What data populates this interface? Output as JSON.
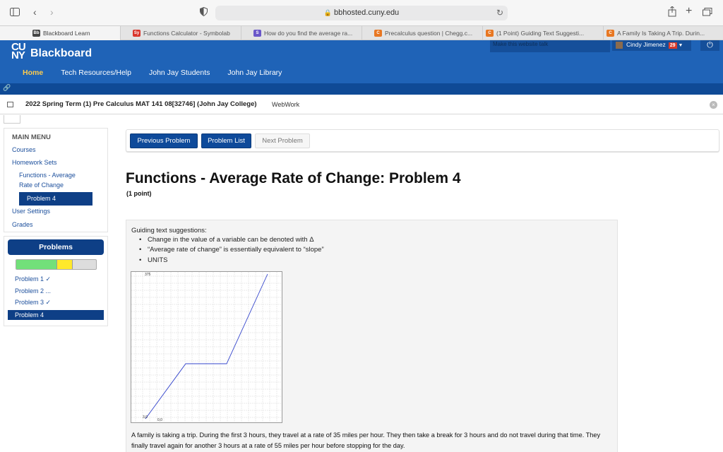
{
  "browser": {
    "url": "bbhosted.cuny.edu",
    "tabs": [
      {
        "label": "Blackboard Learn",
        "fav": "Bb",
        "color": "#444444"
      },
      {
        "label": "Functions Calculator - Symbolab",
        "fav": "Sy",
        "color": "#d9352b"
      },
      {
        "label": "How do you find the average ra...",
        "fav": "S",
        "color": "#6a57c9"
      },
      {
        "label": "Precalculus question | Chegg.c...",
        "fav": "C",
        "color": "#e87722"
      },
      {
        "label": "(1 Point) Guiding Text Suggesti...",
        "fav": "C",
        "color": "#e87722"
      },
      {
        "label": "A Family Is Taking A Trip. Durin...",
        "fav": "C",
        "color": "#e87722"
      }
    ]
  },
  "header": {
    "logo_cuny": "CU NY",
    "logo_name": "Blackboard",
    "talk_text": "Make this website talk",
    "user_name": "Cindy Jimenez",
    "notif_count": "29",
    "nav": [
      "Home",
      "Tech Resources/Help",
      "John Jay Students",
      "John Jay Library"
    ]
  },
  "course": {
    "title": "2022 Spring Term (1) Pre Calculus MAT 141 08[32746] (John Jay College)",
    "tool": "WebWork"
  },
  "menu": {
    "title": "MAIN MENU",
    "courses": "Courses",
    "homework_sets": "Homework Sets",
    "set_name_1": "Functions - Average",
    "set_name_2": "Rate of Change",
    "active": "Problem 4",
    "user_settings": "User Settings",
    "grades": "Grades"
  },
  "problems_panel": {
    "title": "Problems",
    "progress_correct": 0.5,
    "progress_partial": 0.21,
    "items": [
      "Problem 1 ✓",
      "Problem 2 ...",
      "Problem 3 ✓",
      "Problem 4"
    ]
  },
  "buttons": {
    "previous": "Previous Problem",
    "list": "Problem List",
    "next": "Next Problem"
  },
  "problem": {
    "title": "Functions - Average Rate of Change: Problem 4",
    "points": "(1 point)",
    "guide_title": "Guiding text suggestions:",
    "guide_items": [
      "Change in the value of a variable can be denoted with Δ",
      "“Average rate of change” is essentially equivalent to “slope”",
      "UNITS"
    ],
    "graph": {
      "y_top_label": "375",
      "origin_label": "3,0",
      "x_label": "0,0",
      "line_color": "#3344cc"
    },
    "text": "A family is taking a trip. During the first 3 hours, they travel at a rate of 35 miles per hour. They then take a break for 3 hours and do not travel during that time. They finally travel again for another 3 hours at a rate of 55 miles per hour before stopping for the day."
  }
}
